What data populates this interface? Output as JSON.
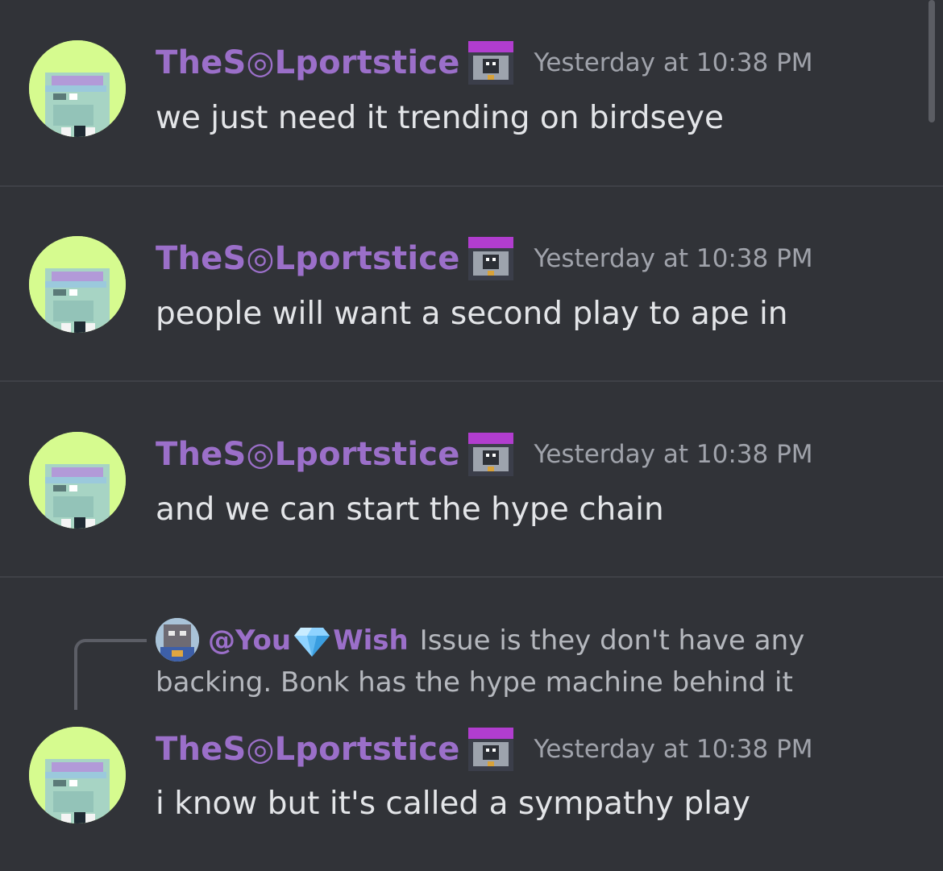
{
  "messages": [
    {
      "username": "TheS◎Lportstice",
      "timestamp": "Yesterday at 10:38 PM",
      "content": "we just need it trending on birdseye"
    },
    {
      "username": "TheS◎Lportstice",
      "timestamp": "Yesterday at 10:38 PM",
      "content": "people will want a second play to ape in"
    },
    {
      "username": "TheS◎Lportstice",
      "timestamp": "Yesterday at 10:38 PM",
      "content": "and we can start the hype chain"
    },
    {
      "username": "TheS◎Lportstice",
      "timestamp": "Yesterday at 10:38 PM",
      "content": "i know but it's called a sympathy play",
      "reply": {
        "mention_prefix": "@You",
        "mention_suffix": "Wish",
        "text_line1": "Issue is they don't have any",
        "text_line2": "backing. Bonk has the hype machine behind it"
      }
    }
  ],
  "icons": {
    "avatar": "pixel-art-avatar-icon",
    "badge": "role-badge-icon",
    "gem": "diamond-icon"
  },
  "colors": {
    "background": "#313338",
    "username": "#9b6fc9",
    "timestamp": "#a0a3ab",
    "content": "#e3e5e8",
    "divider": "#3f4147"
  }
}
